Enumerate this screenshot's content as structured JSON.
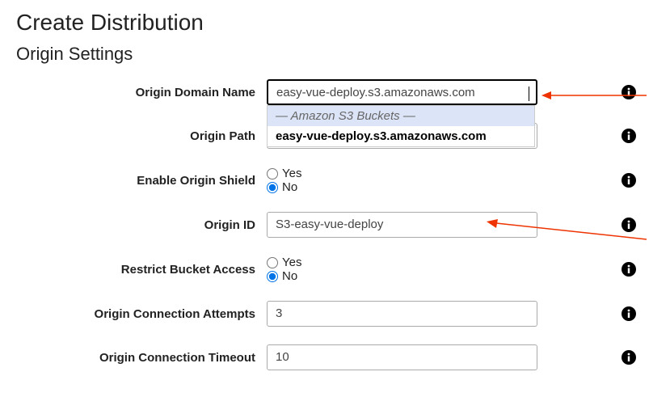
{
  "page_title": "Create Distribution",
  "section_title": "Origin Settings",
  "fields": {
    "origin_domain_name": {
      "label": "Origin Domain Name",
      "value": "easy-vue-deploy.s3.amazonaws.com"
    },
    "origin_path": {
      "label": "Origin Path",
      "value": ""
    },
    "enable_origin_shield": {
      "label": "Enable Origin Shield",
      "yes": "Yes",
      "no": "No",
      "selected": "No"
    },
    "origin_id": {
      "label": "Origin ID",
      "value": "S3-easy-vue-deploy"
    },
    "restrict_bucket_access": {
      "label": "Restrict Bucket Access",
      "yes": "Yes",
      "no": "No",
      "selected": "No"
    },
    "origin_connection_attempts": {
      "label": "Origin Connection Attempts",
      "value": "3"
    },
    "origin_connection_timeout": {
      "label": "Origin Connection Timeout",
      "value": "10"
    }
  },
  "autocomplete": {
    "heading": "— Amazon S3 Buckets —",
    "option": "easy-vue-deploy.s3.amazonaws.com"
  }
}
